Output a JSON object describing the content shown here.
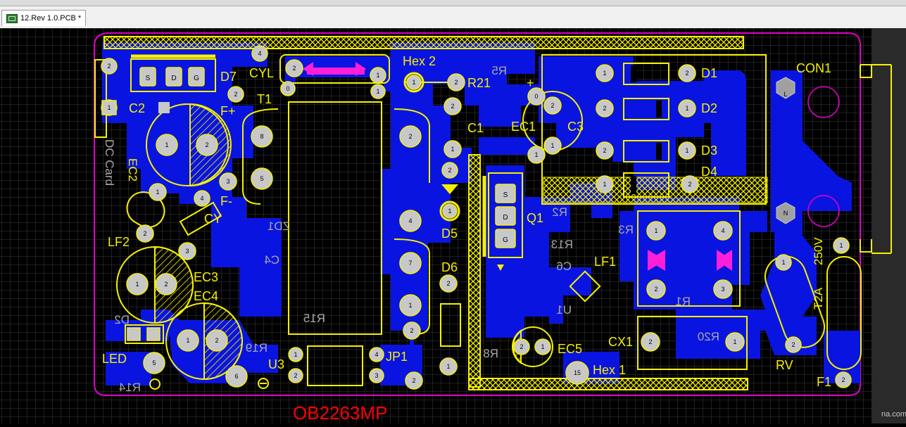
{
  "tab": {
    "title": "12.Rev 1.0.PCB *",
    "icon": "pcb-file-icon"
  },
  "colors": {
    "background": "#000000",
    "grid": "#3c3c3c",
    "top_copper": "#0a14e0",
    "silkscreen": "#f5f000",
    "bottom_silk": "#a8a8a8",
    "board_outline": "#e000c8",
    "pad": "#c8c8c8",
    "magenta": "#ff1fd8",
    "annotation": "#ff0000"
  },
  "components": {
    "d1": "D1",
    "d2": "D2",
    "d3": "D3",
    "d4": "D4",
    "con1": "CON1",
    "cyl": "CYL",
    "hex2": "Hex 2",
    "hex1": "Hex 1",
    "r21": "R21",
    "d7": "D7",
    "t1": "T1",
    "c2": "C2",
    "ec2": "EC2",
    "ec1": "EC1",
    "c3": "C3",
    "c1": "C1",
    "fplus": "F+",
    "fminus": "F-",
    "cy": "CY",
    "lf2": "LF2",
    "ec3": "EC3",
    "ec4": "EC4",
    "led": "LED",
    "u3": "U3",
    "jp1": "JP1",
    "d5": "D5",
    "d6": "D6",
    "q1": "Q1",
    "lf1": "LF1",
    "ec5": "EC5",
    "cx1": "CX1",
    "rv": "RV",
    "f1": "F1",
    "rating_v": "250V",
    "rating_a": "T2A",
    "dc_card": "DC Card",
    "pin_s": "S",
    "pin_d": "D",
    "pin_g": "G"
  },
  "bottom_labels": {
    "r5": "R5",
    "r2": "R2",
    "r3": "R3",
    "r13": "R13",
    "c6": "C6",
    "u1": "U1",
    "r1": "R1",
    "c4": "C4",
    "r15": "R15",
    "r19": "R19",
    "zd1": "ZD1",
    "d2b": "D2",
    "r14": "R14",
    "r20": "R20",
    "r8": "R8"
  },
  "annotation": "OB2263MP",
  "watermark": "na.com"
}
